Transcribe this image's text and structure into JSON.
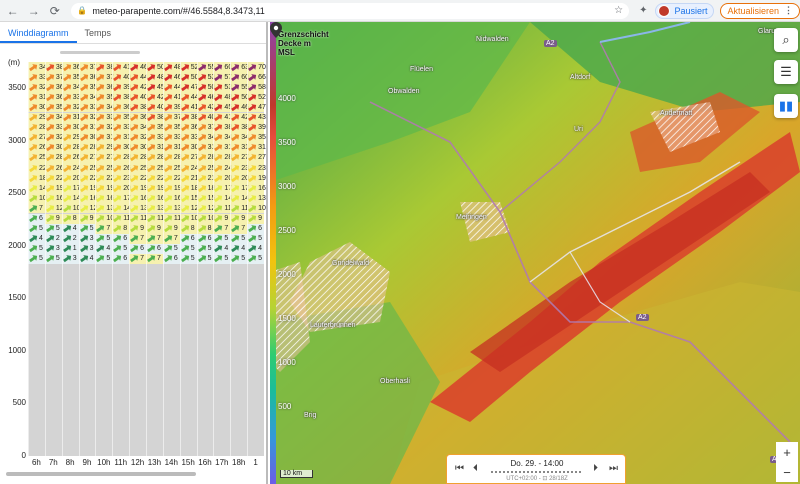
{
  "browser": {
    "url": "meteo-parapente.com/#/46.5584,8.3473,11",
    "pause_label": "Pausiert",
    "update_label": "Aktualisieren"
  },
  "tabs": [
    {
      "label": "Winddiagramm",
      "active": true
    },
    {
      "label": "Temps",
      "active": false
    }
  ],
  "diagram": {
    "unit": "(m)",
    "y_ticks": [
      "3500",
      "3000",
      "2500",
      "2000",
      "1500",
      "1000",
      "500",
      "0"
    ],
    "hours": [
      "6h",
      "7h",
      "8h",
      "9h",
      "10h",
      "11h",
      "12h",
      "13h",
      "14h",
      "15h",
      "16h",
      "17h",
      "18h",
      "1"
    ],
    "wind_rows": [
      [
        "34",
        "38",
        "36",
        "37",
        "38",
        "41",
        "46",
        "50",
        "48",
        "52",
        "55",
        "60",
        "63",
        "70"
      ],
      [
        "33",
        "37",
        "35",
        "36",
        "37",
        "40",
        "44",
        "48",
        "46",
        "50",
        "53",
        "57",
        "60",
        "66"
      ],
      [
        "32",
        "36",
        "34",
        "35",
        "36",
        "39",
        "42",
        "45",
        "44",
        "47",
        "50",
        "53",
        "55",
        "58"
      ],
      [
        "31",
        "36",
        "33",
        "34",
        "35",
        "38",
        "40",
        "42",
        "41",
        "44",
        "46",
        "48",
        "50",
        "52"
      ],
      [
        "30",
        "35",
        "32",
        "33",
        "34",
        "36",
        "38",
        "40",
        "39",
        "41",
        "43",
        "45",
        "46",
        "47"
      ],
      [
        "29",
        "34",
        "31",
        "32",
        "33",
        "35",
        "36",
        "38",
        "37",
        "38",
        "40",
        "41",
        "42",
        "43"
      ],
      [
        "28",
        "33",
        "30",
        "31",
        "32",
        "33",
        "34",
        "35",
        "35",
        "36",
        "37",
        "38",
        "38",
        "39"
      ],
      [
        "27",
        "32",
        "29",
        "30",
        "31",
        "31",
        "32",
        "33",
        "33",
        "33",
        "34",
        "34",
        "34",
        "35"
      ],
      [
        "26",
        "30",
        "28",
        "28",
        "29",
        "30",
        "30",
        "31",
        "31",
        "30",
        "31",
        "31",
        "31",
        "31"
      ],
      [
        "25",
        "28",
        "26",
        "27",
        "27",
        "28",
        "28",
        "28",
        "28",
        "27",
        "28",
        "28",
        "27",
        "27"
      ],
      [
        "22",
        "26",
        "24",
        "25",
        "25",
        "26",
        "25",
        "25",
        "25",
        "24",
        "25",
        "24",
        "23",
        "23"
      ],
      [
        "18",
        "22",
        "20",
        "22",
        "22",
        "23",
        "22",
        "22",
        "22",
        "21",
        "21",
        "20",
        "20",
        "19"
      ],
      [
        "14",
        "19",
        "17",
        "19",
        "19",
        "20",
        "19",
        "19",
        "19",
        "18",
        "18",
        "17",
        "17",
        "16"
      ],
      [
        "10",
        "16",
        "14",
        "16",
        "16",
        "17",
        "16",
        "16",
        "16",
        "15",
        "15",
        "14",
        "14",
        "13"
      ],
      [
        "7",
        "12",
        "10",
        "12",
        "13",
        "14",
        "13",
        "13",
        "13",
        "12",
        "12",
        "11",
        "11",
        "10"
      ],
      [
        "6",
        "9",
        "8",
        "9",
        "10",
        "11",
        "11",
        "11",
        "11",
        "10",
        "10",
        "9",
        "9",
        "9"
      ],
      [
        "5",
        "5",
        "4",
        "5",
        "7",
        "8",
        "9",
        "9",
        "9",
        "8",
        "8",
        "7",
        "7",
        "6"
      ],
      [
        "4",
        "2",
        "2",
        "3",
        "5",
        "6",
        "7",
        "7",
        "7",
        "6",
        "6",
        "5",
        "5",
        "5"
      ],
      [
        "5",
        "3",
        "1",
        "3",
        "4",
        "5",
        "6",
        "6",
        "5",
        "5",
        "5",
        "4",
        "4",
        "4"
      ],
      [
        "5",
        "5",
        "3",
        "4",
        "5",
        "6",
        "7",
        "7",
        "6",
        "5",
        "5",
        "5",
        "5",
        "5"
      ]
    ]
  },
  "map": {
    "legend_title": "Grenzschicht Decke m MSL",
    "legend_ticks": [
      "4000",
      "3500",
      "3000",
      "2500",
      "2000",
      "1500",
      "1000",
      "500"
    ],
    "places": [
      {
        "name": "Nidwalden"
      },
      {
        "name": "Altdorf"
      },
      {
        "name": "Uri"
      },
      {
        "name": "Flüelen"
      },
      {
        "name": "Obwalden"
      },
      {
        "name": "Glarus"
      },
      {
        "name": "Meiringen"
      },
      {
        "name": "Grindelwald"
      },
      {
        "name": "Andermatt"
      },
      {
        "name": "Lauterbrunnen"
      },
      {
        "name": "Oberhasli"
      },
      {
        "name": "Brig"
      }
    ],
    "roads": [
      "A2",
      "A2",
      "A2"
    ],
    "scale_label": "10 km"
  },
  "time_control": {
    "label": "Do. 29. - 14:00",
    "sub": "UTC+02:00 - ⊡ 28/18Z"
  },
  "icons": {
    "search": "search-icon",
    "settings": "sliders-icon",
    "chart": "bar-chart-icon"
  },
  "colors": {
    "accent": "#1a73e8",
    "update": "#e8710a",
    "time_border": "#f0a030"
  }
}
